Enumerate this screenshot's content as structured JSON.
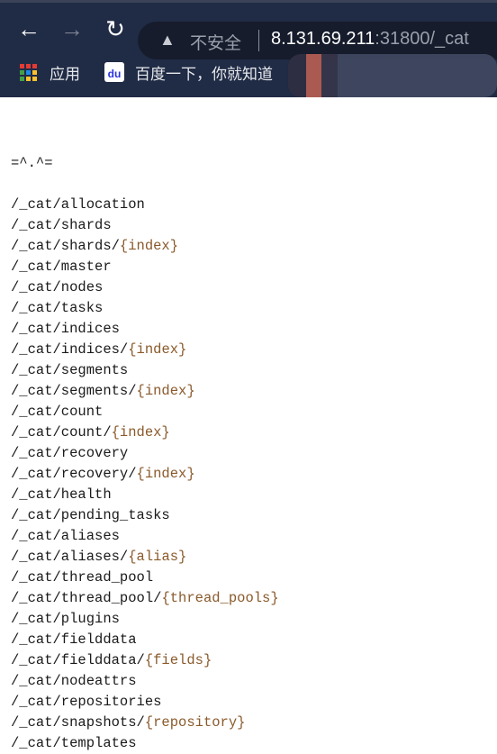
{
  "browser": {
    "back_icon": "arrow-left-icon",
    "forward_icon": "arrow-right-icon",
    "reload_icon": "reload-icon",
    "security_label": "不安全",
    "url_host": "8.131.69.211",
    "url_rest": ":31800/_cat",
    "bookmarks": [
      {
        "label": "应用",
        "icon": "apps-grid-icon"
      },
      {
        "label": "百度一下，你就知道",
        "icon": "baidu-paw-icon"
      }
    ]
  },
  "page": {
    "header": "=^.^=",
    "lines": [
      {
        "path": "/_cat/allocation",
        "param": ""
      },
      {
        "path": "/_cat/shards",
        "param": ""
      },
      {
        "path": "/_cat/shards/",
        "param": "{index}"
      },
      {
        "path": "/_cat/master",
        "param": ""
      },
      {
        "path": "/_cat/nodes",
        "param": ""
      },
      {
        "path": "/_cat/tasks",
        "param": ""
      },
      {
        "path": "/_cat/indices",
        "param": ""
      },
      {
        "path": "/_cat/indices/",
        "param": "{index}"
      },
      {
        "path": "/_cat/segments",
        "param": ""
      },
      {
        "path": "/_cat/segments/",
        "param": "{index}"
      },
      {
        "path": "/_cat/count",
        "param": ""
      },
      {
        "path": "/_cat/count/",
        "param": "{index}"
      },
      {
        "path": "/_cat/recovery",
        "param": ""
      },
      {
        "path": "/_cat/recovery/",
        "param": "{index}"
      },
      {
        "path": "/_cat/health",
        "param": ""
      },
      {
        "path": "/_cat/pending_tasks",
        "param": ""
      },
      {
        "path": "/_cat/aliases",
        "param": ""
      },
      {
        "path": "/_cat/aliases/",
        "param": "{alias}"
      },
      {
        "path": "/_cat/thread_pool",
        "param": ""
      },
      {
        "path": "/_cat/thread_pool/",
        "param": "{thread_pools}"
      },
      {
        "path": "/_cat/plugins",
        "param": ""
      },
      {
        "path": "/_cat/fielddata",
        "param": ""
      },
      {
        "path": "/_cat/fielddata/",
        "param": "{fields}"
      },
      {
        "path": "/_cat/nodeattrs",
        "param": ""
      },
      {
        "path": "/_cat/repositories",
        "param": ""
      },
      {
        "path": "/_cat/snapshots/",
        "param": "{repository}"
      },
      {
        "path": "/_cat/templates",
        "param": ""
      }
    ]
  }
}
